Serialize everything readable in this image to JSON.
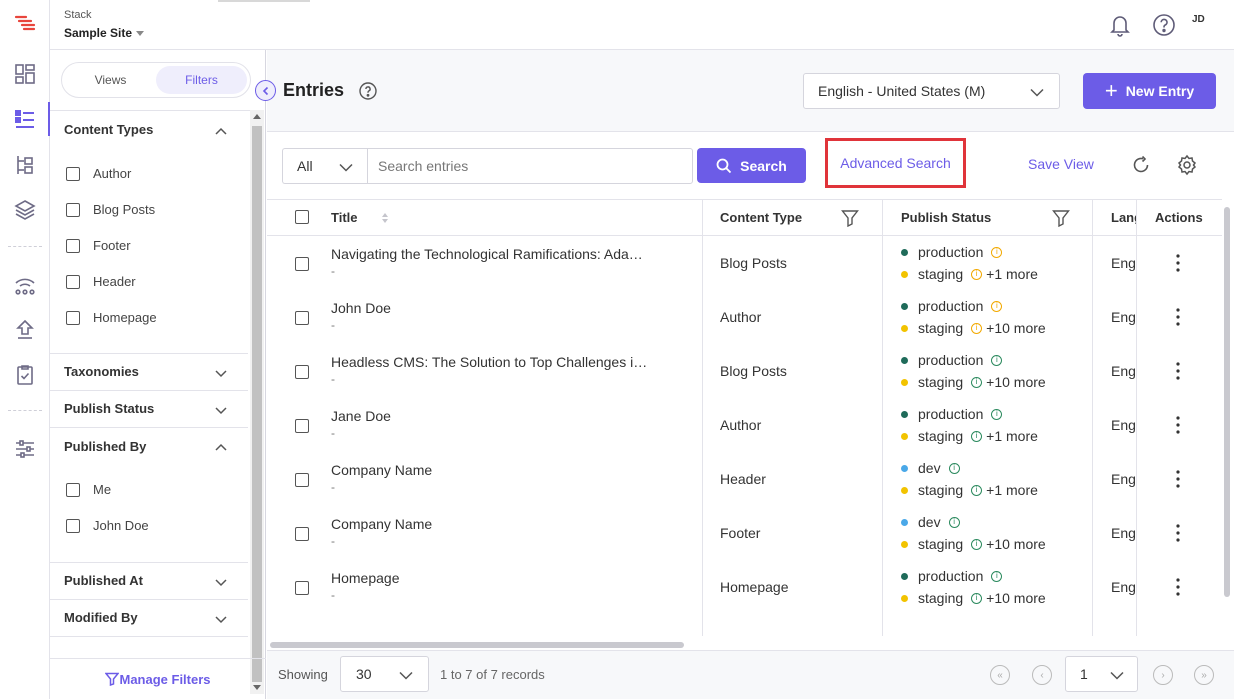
{
  "header": {
    "stack_label": "Stack",
    "site_name": "Sample Site",
    "avatar_initials": "JD"
  },
  "filter_panel": {
    "tabs": [
      {
        "label": "Views",
        "active": false
      },
      {
        "label": "Filters",
        "active": true
      }
    ],
    "sections": {
      "content_types": {
        "title": "Content Types",
        "options": [
          "Author",
          "Blog Posts",
          "Footer",
          "Header",
          "Homepage"
        ]
      },
      "taxonomies": {
        "title": "Taxonomies"
      },
      "publish_status": {
        "title": "Publish Status"
      },
      "published_by": {
        "title": "Published By",
        "options": [
          "Me",
          "John Doe"
        ]
      },
      "published_at": {
        "title": "Published At"
      },
      "modified_by": {
        "title": "Modified By"
      }
    },
    "manage_filters_label": "Manage Filters"
  },
  "main": {
    "title": "Entries",
    "language_select": "English - United States (M)",
    "new_entry_label": "New Entry",
    "search_scope": "All",
    "search_placeholder": "Search entries",
    "search_button": "Search",
    "advanced_search": "Advanced Search",
    "save_view": "Save View"
  },
  "table": {
    "columns": {
      "title": "Title",
      "content_type": "Content Type",
      "publish_status": "Publish Status",
      "language": "Lang",
      "actions": "Actions"
    },
    "rows": [
      {
        "title": "Navigating the Technological Ramifications: Ada…",
        "sub": "-",
        "content_type": "Blog Posts",
        "status": [
          {
            "env": "production",
            "more": ""
          },
          {
            "env": "staging",
            "more": "+1 more"
          }
        ],
        "lang": "Eng"
      },
      {
        "title": "John Doe",
        "sub": "-",
        "content_type": "Author",
        "status": [
          {
            "env": "production",
            "more": ""
          },
          {
            "env": "staging",
            "more": "+10 more"
          }
        ],
        "lang": "Eng"
      },
      {
        "title": "Headless CMS: The Solution to Top Challenges i…",
        "sub": "-",
        "content_type": "Blog Posts",
        "status": [
          {
            "env": "production",
            "more": ""
          },
          {
            "env": "staging",
            "more": "+10 more"
          }
        ],
        "lang": "Eng"
      },
      {
        "title": "Jane Doe",
        "sub": "-",
        "content_type": "Author",
        "status": [
          {
            "env": "production",
            "more": ""
          },
          {
            "env": "staging",
            "more": "+1 more"
          }
        ],
        "lang": "Eng"
      },
      {
        "title": "Company Name",
        "sub": "-",
        "content_type": "Header",
        "status": [
          {
            "env": "dev",
            "more": ""
          },
          {
            "env": "staging",
            "more": "+1 more"
          }
        ],
        "lang": "Eng"
      },
      {
        "title": "Company Name",
        "sub": "-",
        "content_type": "Footer",
        "status": [
          {
            "env": "dev",
            "more": ""
          },
          {
            "env": "staging",
            "more": "+10 more"
          }
        ],
        "lang": "Eng"
      },
      {
        "title": "Homepage",
        "sub": "-",
        "content_type": "Homepage",
        "status": [
          {
            "env": "production",
            "more": ""
          },
          {
            "env": "staging",
            "more": "+10 more"
          }
        ],
        "lang": "Eng"
      }
    ]
  },
  "footer": {
    "showing_label": "Showing",
    "per_page": "30",
    "records_text": "1 to 7 of 7 records",
    "page": "1"
  },
  "colors": {
    "accent": "#6c5ce7",
    "production_dot": "#1f6b5a",
    "staging_dot": "#f2c300",
    "dev_dot": "#4aa8e8",
    "highlight_box": "#e0343a"
  }
}
